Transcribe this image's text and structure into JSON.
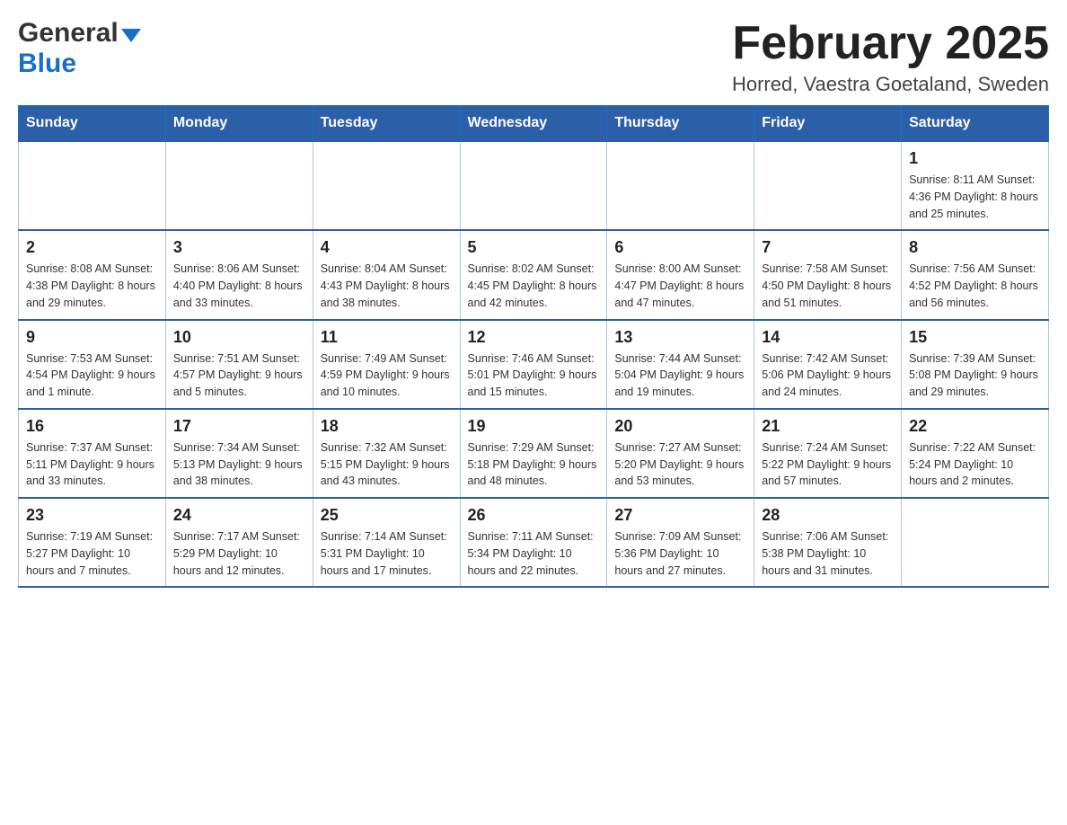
{
  "header": {
    "logo_general": "General",
    "logo_blue": "Blue",
    "main_title": "February 2025",
    "subtitle": "Horred, Vaestra Goetaland, Sweden"
  },
  "days_of_week": [
    "Sunday",
    "Monday",
    "Tuesday",
    "Wednesday",
    "Thursday",
    "Friday",
    "Saturday"
  ],
  "weeks": [
    [
      {
        "day": "",
        "info": ""
      },
      {
        "day": "",
        "info": ""
      },
      {
        "day": "",
        "info": ""
      },
      {
        "day": "",
        "info": ""
      },
      {
        "day": "",
        "info": ""
      },
      {
        "day": "",
        "info": ""
      },
      {
        "day": "1",
        "info": "Sunrise: 8:11 AM\nSunset: 4:36 PM\nDaylight: 8 hours and 25 minutes."
      }
    ],
    [
      {
        "day": "2",
        "info": "Sunrise: 8:08 AM\nSunset: 4:38 PM\nDaylight: 8 hours and 29 minutes."
      },
      {
        "day": "3",
        "info": "Sunrise: 8:06 AM\nSunset: 4:40 PM\nDaylight: 8 hours and 33 minutes."
      },
      {
        "day": "4",
        "info": "Sunrise: 8:04 AM\nSunset: 4:43 PM\nDaylight: 8 hours and 38 minutes."
      },
      {
        "day": "5",
        "info": "Sunrise: 8:02 AM\nSunset: 4:45 PM\nDaylight: 8 hours and 42 minutes."
      },
      {
        "day": "6",
        "info": "Sunrise: 8:00 AM\nSunset: 4:47 PM\nDaylight: 8 hours and 47 minutes."
      },
      {
        "day": "7",
        "info": "Sunrise: 7:58 AM\nSunset: 4:50 PM\nDaylight: 8 hours and 51 minutes."
      },
      {
        "day": "8",
        "info": "Sunrise: 7:56 AM\nSunset: 4:52 PM\nDaylight: 8 hours and 56 minutes."
      }
    ],
    [
      {
        "day": "9",
        "info": "Sunrise: 7:53 AM\nSunset: 4:54 PM\nDaylight: 9 hours and 1 minute."
      },
      {
        "day": "10",
        "info": "Sunrise: 7:51 AM\nSunset: 4:57 PM\nDaylight: 9 hours and 5 minutes."
      },
      {
        "day": "11",
        "info": "Sunrise: 7:49 AM\nSunset: 4:59 PM\nDaylight: 9 hours and 10 minutes."
      },
      {
        "day": "12",
        "info": "Sunrise: 7:46 AM\nSunset: 5:01 PM\nDaylight: 9 hours and 15 minutes."
      },
      {
        "day": "13",
        "info": "Sunrise: 7:44 AM\nSunset: 5:04 PM\nDaylight: 9 hours and 19 minutes."
      },
      {
        "day": "14",
        "info": "Sunrise: 7:42 AM\nSunset: 5:06 PM\nDaylight: 9 hours and 24 minutes."
      },
      {
        "day": "15",
        "info": "Sunrise: 7:39 AM\nSunset: 5:08 PM\nDaylight: 9 hours and 29 minutes."
      }
    ],
    [
      {
        "day": "16",
        "info": "Sunrise: 7:37 AM\nSunset: 5:11 PM\nDaylight: 9 hours and 33 minutes."
      },
      {
        "day": "17",
        "info": "Sunrise: 7:34 AM\nSunset: 5:13 PM\nDaylight: 9 hours and 38 minutes."
      },
      {
        "day": "18",
        "info": "Sunrise: 7:32 AM\nSunset: 5:15 PM\nDaylight: 9 hours and 43 minutes."
      },
      {
        "day": "19",
        "info": "Sunrise: 7:29 AM\nSunset: 5:18 PM\nDaylight: 9 hours and 48 minutes."
      },
      {
        "day": "20",
        "info": "Sunrise: 7:27 AM\nSunset: 5:20 PM\nDaylight: 9 hours and 53 minutes."
      },
      {
        "day": "21",
        "info": "Sunrise: 7:24 AM\nSunset: 5:22 PM\nDaylight: 9 hours and 57 minutes."
      },
      {
        "day": "22",
        "info": "Sunrise: 7:22 AM\nSunset: 5:24 PM\nDaylight: 10 hours and 2 minutes."
      }
    ],
    [
      {
        "day": "23",
        "info": "Sunrise: 7:19 AM\nSunset: 5:27 PM\nDaylight: 10 hours and 7 minutes."
      },
      {
        "day": "24",
        "info": "Sunrise: 7:17 AM\nSunset: 5:29 PM\nDaylight: 10 hours and 12 minutes."
      },
      {
        "day": "25",
        "info": "Sunrise: 7:14 AM\nSunset: 5:31 PM\nDaylight: 10 hours and 17 minutes."
      },
      {
        "day": "26",
        "info": "Sunrise: 7:11 AM\nSunset: 5:34 PM\nDaylight: 10 hours and 22 minutes."
      },
      {
        "day": "27",
        "info": "Sunrise: 7:09 AM\nSunset: 5:36 PM\nDaylight: 10 hours and 27 minutes."
      },
      {
        "day": "28",
        "info": "Sunrise: 7:06 AM\nSunset: 5:38 PM\nDaylight: 10 hours and 31 minutes."
      },
      {
        "day": "",
        "info": ""
      }
    ]
  ]
}
